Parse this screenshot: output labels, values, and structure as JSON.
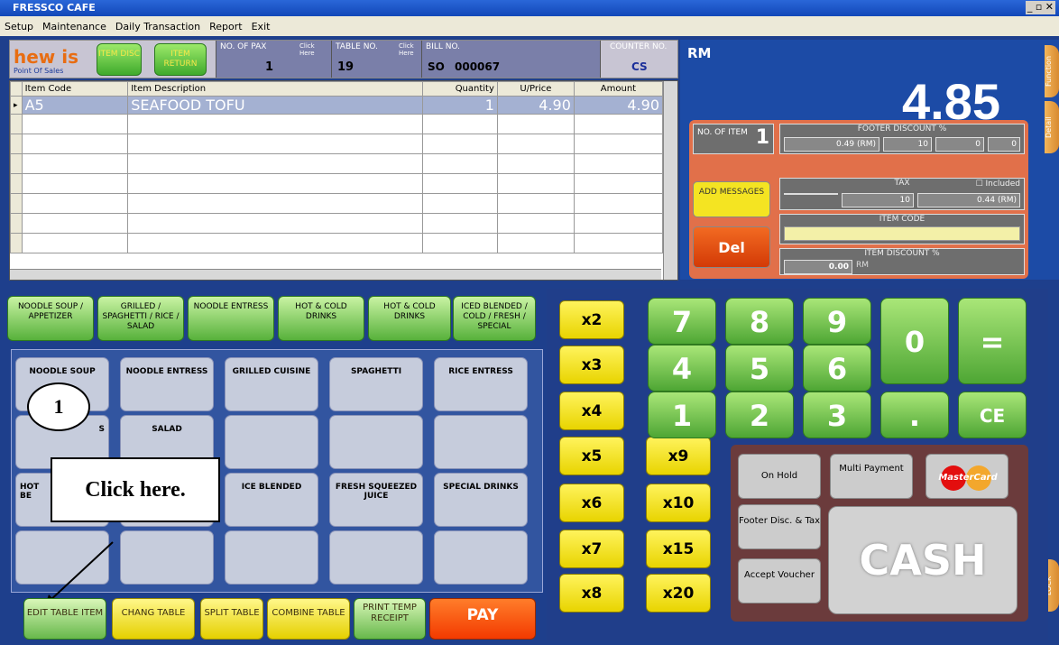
{
  "app": {
    "title": "FRESSCO CAFE"
  },
  "menu": [
    "Setup",
    "Maintenance",
    "Daily Transaction",
    "Report",
    "Exit"
  ],
  "header": {
    "logo": "hew is",
    "logo_sub": "Point Of Sales",
    "item_disc": "ITEM DISC",
    "item_return": "ITEM RETURN",
    "no_of_pax_label": "NO. OF PAX",
    "click_here": "Click Here",
    "pax": "1",
    "table_no_label": "TABLE NO.",
    "table_no": "19",
    "bill_no_label": "BILL NO.",
    "bill_prefix": "SO",
    "bill_no": "000067",
    "counter_no_label": "COUNTER NO.",
    "counter": "CS"
  },
  "grid": {
    "columns": [
      "Item Code",
      "Item Description",
      "Quantity",
      "U/Price",
      "Amount"
    ],
    "rows": [
      {
        "code": "A5",
        "desc": "SEAFOOD TOFU",
        "qty": "1",
        "price": "4.90",
        "amount": "4.90"
      }
    ]
  },
  "summary": {
    "currency": "RM",
    "total": "4.85",
    "no_of_item_label": "NO. OF ITEM",
    "no_of_item": "1",
    "footer_disc_label": "FOOTER DISCOUNT %",
    "footer_disc_rm": "0.49 (RM)",
    "footer_disc_pct": "10",
    "footer_disc_v": "0",
    "footer_disc_v2": "0",
    "tax_label": "TAX",
    "included": "Included",
    "tax_pct": "10",
    "tax_rm": "0.44 (RM)",
    "item_code_label": "ITEM CODE",
    "item_disc_label": "ITEM DISCOUNT %",
    "item_disc_rm": "0.00",
    "rm": "RM",
    "add_messages": "ADD MESSAGES",
    "del": "Del"
  },
  "sidetabs": [
    "Function",
    "Detail",
    "LOCK"
  ],
  "categories": [
    "NOODLE SOUP / APPETIZER",
    "GRILLED / SPAGHETTI / RICE / SALAD",
    "NOODLE ENTRESS",
    "HOT & COLD DRINKS",
    "HOT & COLD DRINKS",
    "ICED BLENDED / COLD / FRESH / SPECIAL"
  ],
  "items": [
    "NOODLE SOUP",
    "NOODLE ENTRESS",
    "GRILLED CUISINE",
    "SPAGHETTI",
    "RICE ENTRESS",
    "SALAD",
    "ICE BLENDED",
    "FRESH SQUEEZED JUICE",
    "SPECIAL DRINKS"
  ],
  "partial_items": {
    "s": "S",
    "hot": "HOT",
    "bev": "BE"
  },
  "callouts": {
    "number": "1",
    "click": "Click here."
  },
  "bottom": [
    "EDIT TABLE ITEM",
    "CHANG TABLE",
    "SPLIT TABLE",
    "COMBINE TABLE",
    "PRINT TEMP RECEIPT",
    "PAY"
  ],
  "multipliers": [
    "x2",
    "x3",
    "x4",
    "x5",
    "x6",
    "x7",
    "x8",
    "x9",
    "x10",
    "x15",
    "x20"
  ],
  "numpad": [
    "7",
    "8",
    "9",
    "4",
    "5",
    "6",
    "1",
    "2",
    "3",
    ".",
    "0",
    "=",
    "CE"
  ],
  "payments": {
    "on_hold": "On Hold",
    "multi": "Multi Payment",
    "mastercard": "MasterCard",
    "footer": "Footer Disc. & Tax",
    "voucher": "Accept Voucher",
    "cash": "CASH"
  }
}
